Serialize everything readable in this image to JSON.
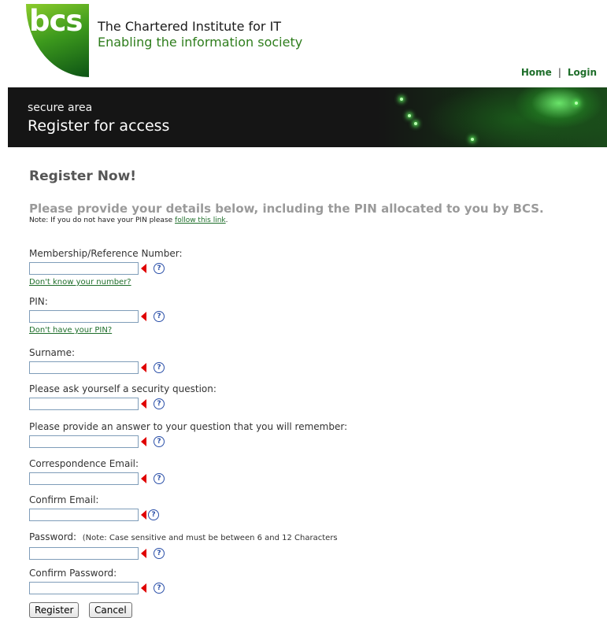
{
  "brand": {
    "logo_text": "bcs",
    "tagline_line1": "The Chartered Institute for IT",
    "tagline_line2": "Enabling the information society"
  },
  "topnav": {
    "home": "Home",
    "separator": "|",
    "login": "Login"
  },
  "banner": {
    "section": "secure area",
    "title": "Register for access"
  },
  "page": {
    "heading": "Register Now!",
    "intro": "Please provide your details below, including the PIN allocated to you by BCS.",
    "note_prefix": "Note: If you do not have your PIN please ",
    "note_link": "follow this link",
    "note_suffix": "."
  },
  "form": {
    "fields": [
      {
        "label": "Membership/Reference Number:",
        "value": "",
        "help_link": "Don't know your number?"
      },
      {
        "label": "PIN:",
        "value": "",
        "help_link": "Don't have your PIN?"
      },
      {
        "label": "Surname:",
        "value": ""
      },
      {
        "label": "Please ask yourself a security question:",
        "value": ""
      },
      {
        "label": "Please provide an answer to your question that you will remember:",
        "value": ""
      },
      {
        "label": "Correspondence Email:",
        "value": ""
      },
      {
        "label": "Confirm Email:",
        "value": ""
      },
      {
        "label": "Password:",
        "label_note": "(Note: Case sensitive and must be between 6 and 12 Characters",
        "value": ""
      },
      {
        "label": "Confirm Password:",
        "value": ""
      }
    ],
    "help_glyph": "?",
    "register_button": "Register",
    "cancel_button": "Cancel"
  },
  "colors": {
    "brand_green": "#2e7d1c",
    "link_green": "#1e6e2a",
    "banner_bg": "#151515",
    "required_marker": "#e00000",
    "help_icon": "#2a4fa8"
  }
}
